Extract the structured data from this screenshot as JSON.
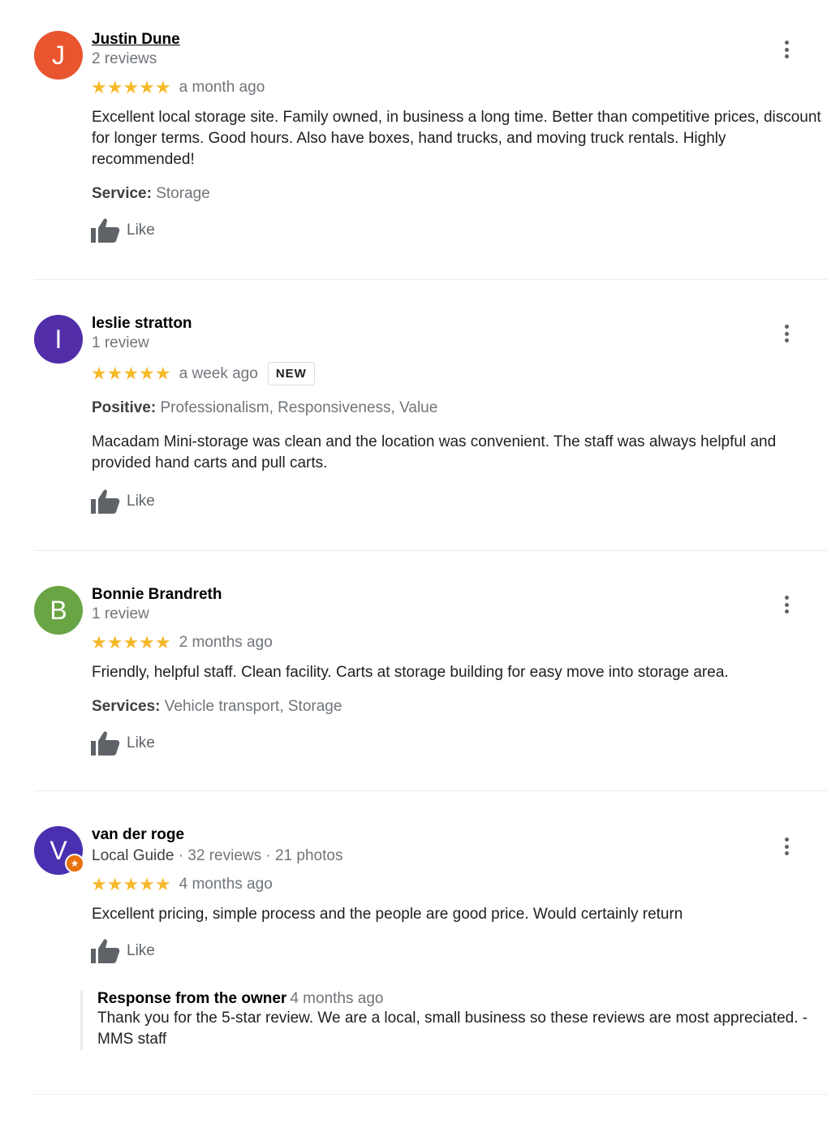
{
  "colors": {
    "star": "#f6b92b",
    "avatar_j": "#e8552f",
    "avatar_i": "#512da8",
    "avatar_b": "#6aa545",
    "avatar_v": "#4a2fb0",
    "badge": "#e8710a"
  },
  "reviews": [
    {
      "initial": "J",
      "name": "Justin Dune",
      "meta": "2 reviews",
      "stars": "★★★★★",
      "ago": "a month ago",
      "text": "Excellent local storage site.  Family owned, in business a long time.  Better than competitive prices, discount for longer terms.  Good hours.  Also have boxes, hand trucks, and moving truck rentals.  Highly recommended!",
      "attr_label": "Service:",
      "attr_value": "Storage",
      "like": "Like"
    },
    {
      "initial": "I",
      "name": "leslie stratton",
      "meta": "1 review",
      "stars": "★★★★★",
      "ago": "a week ago",
      "badge": "NEW",
      "attr_label": "Positive:",
      "attr_value": "Professionalism, Responsiveness, Value",
      "text": "Macadam Mini-storage was clean and the location was convenient.  The staff was always helpful and provided hand carts and pull carts.",
      "like": "Like"
    },
    {
      "initial": "B",
      "name": "Bonnie Brandreth",
      "meta": "1 review",
      "stars": "★★★★★",
      "ago": "2 months ago",
      "text": "Friendly, helpful staff. Clean facility. Carts at storage building for easy move into storage area.",
      "attr_label": "Services:",
      "attr_value": "Vehicle transport, Storage",
      "like": "Like"
    },
    {
      "initial": "V",
      "name": "van der roge",
      "guide": "Local Guide",
      "meta": "· 32 reviews · 21 photos",
      "stars": "★★★★★",
      "ago": "4 months ago",
      "text": "Excellent pricing, simple process and the people are good price. Would certainly return",
      "like": "Like",
      "owner_title": "Response from the owner",
      "owner_ago": "4 months ago",
      "owner_text": "Thank you for the 5-star review. We are a local, small business so these reviews are most appreciated. -MMS staff"
    }
  ]
}
